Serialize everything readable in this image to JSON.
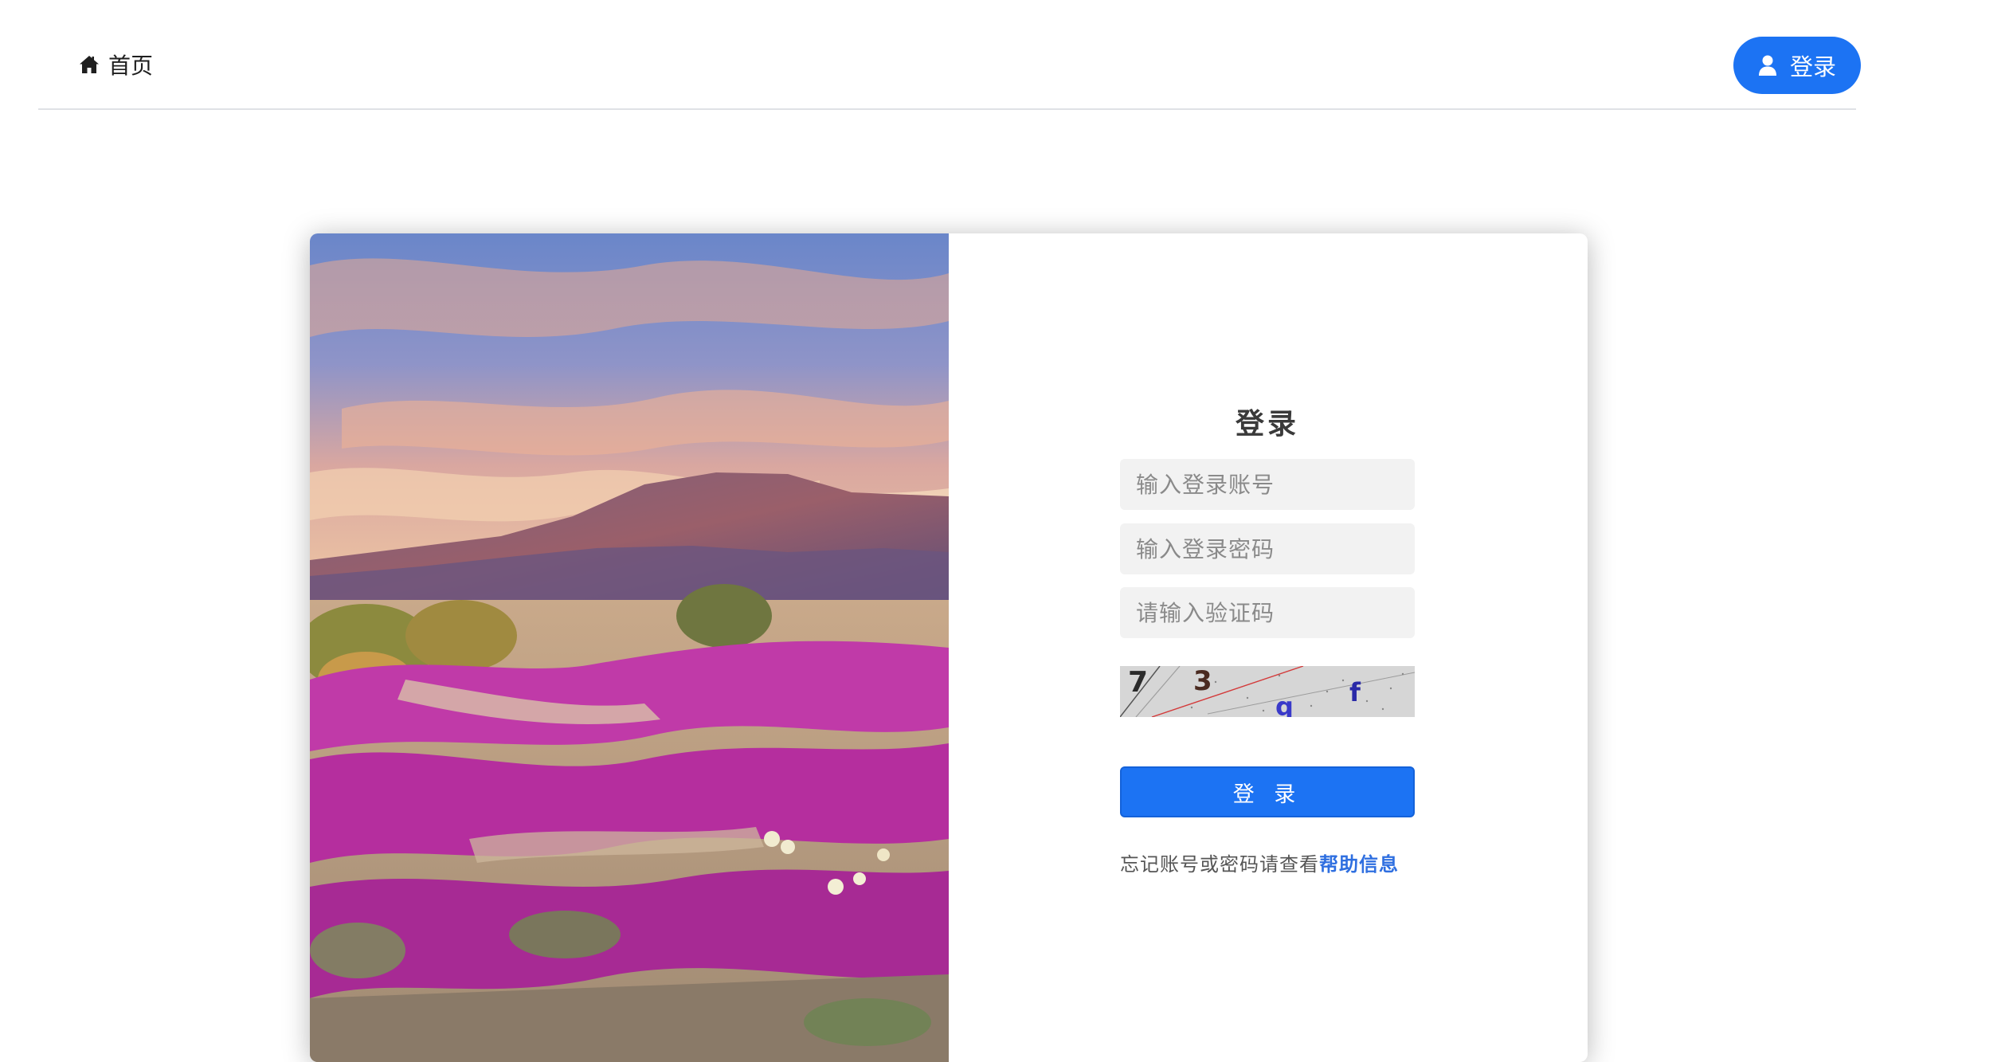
{
  "nav": {
    "home_label": "首页",
    "login_label": "登录"
  },
  "login_form": {
    "title": "登录",
    "username_placeholder": "输入登录账号",
    "password_placeholder": "输入登录密码",
    "captcha_placeholder": "请输入验证码",
    "captcha_characters": [
      "7",
      "3",
      "q",
      "f"
    ],
    "submit_label": "登 录",
    "help_text": "忘记账号或密码请查看",
    "help_link_label": "帮助信息"
  },
  "colors": {
    "primary": "#1c73f3",
    "help_link": "#2f6fe0",
    "input_bg": "#f2f2f2"
  },
  "icons": {
    "home": "home-icon",
    "user": "user-icon"
  }
}
